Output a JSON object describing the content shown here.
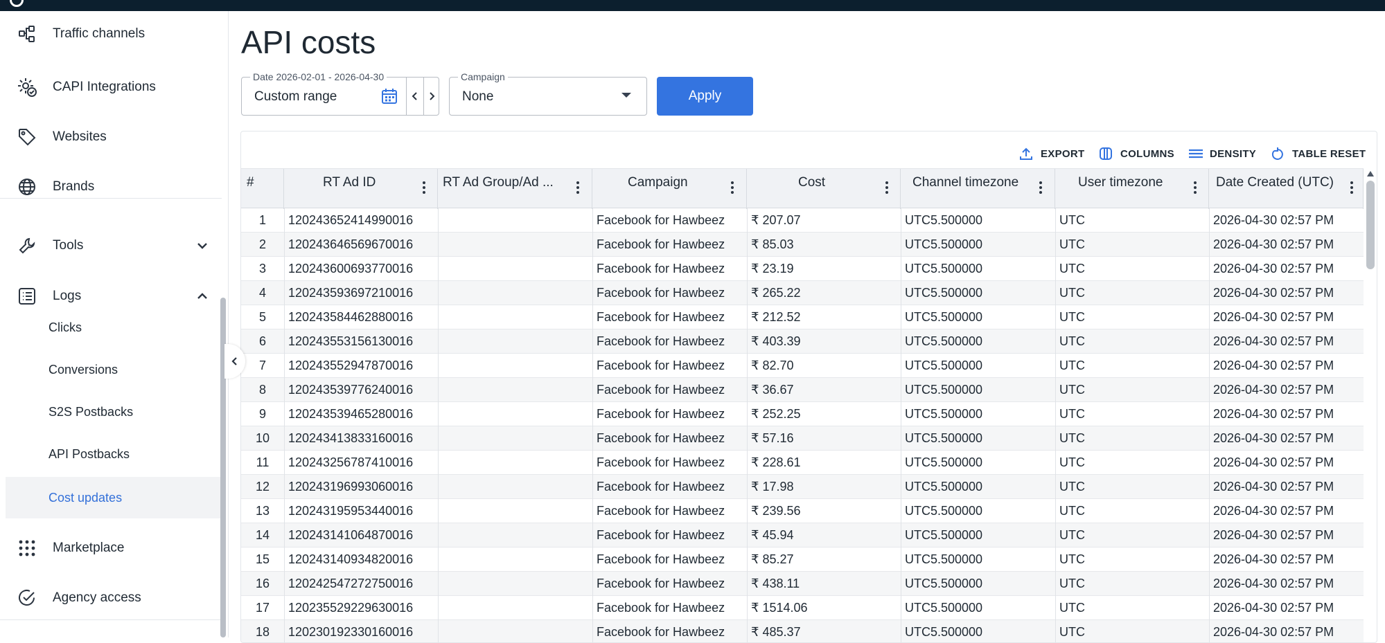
{
  "sidebar": {
    "items": [
      {
        "label": "Traffic channels",
        "icon": "share-nodes-icon"
      },
      {
        "label": "CAPI Integrations",
        "icon": "gear-check-icon"
      },
      {
        "label": "Websites",
        "icon": "tag-icon"
      },
      {
        "label": "Brands",
        "icon": "globe-icon"
      },
      {
        "label": "Tools",
        "icon": "wrench-icon"
      },
      {
        "label": "Logs",
        "icon": "list-icon"
      },
      {
        "label": "Marketplace",
        "icon": "grid-dots-icon"
      },
      {
        "label": "Agency access",
        "icon": "check-circle-icon"
      }
    ],
    "log_sub_items": [
      "Clicks",
      "Conversions",
      "S2S Postbacks",
      "API Postbacks",
      "Cost updates"
    ],
    "active_sub_item": "Cost updates"
  },
  "main": {
    "title": "API costs",
    "date_filter": {
      "legend": "Date 2026-02-01 - 2026-04-30",
      "value": "Custom range"
    },
    "campaign_filter": {
      "legend": "Campaign",
      "value": "None"
    },
    "apply_label": "Apply"
  },
  "toolbar": {
    "export": "EXPORT",
    "columns": "COLUMNS",
    "density": "DENSITY",
    "table_reset": "TABLE RESET"
  },
  "table": {
    "columns": [
      "#",
      "RT Ad ID",
      "RT Ad Group/Ad ...",
      "Campaign",
      "Cost",
      "Channel timezone",
      "User timezone",
      "Date Created (UTC)"
    ],
    "rows": [
      [
        "1",
        "120243652414990016",
        "",
        "Facebook for Hawbeez",
        "₹ 207.07",
        "UTC5.500000",
        "UTC",
        "2026-04-30 02:57 PM"
      ],
      [
        "2",
        "120243646569670016",
        "",
        "Facebook for Hawbeez",
        "₹ 85.03",
        "UTC5.500000",
        "UTC",
        "2026-04-30 02:57 PM"
      ],
      [
        "3",
        "120243600693770016",
        "",
        "Facebook for Hawbeez",
        "₹ 23.19",
        "UTC5.500000",
        "UTC",
        "2026-04-30 02:57 PM"
      ],
      [
        "4",
        "120243593697210016",
        "",
        "Facebook for Hawbeez",
        "₹ 265.22",
        "UTC5.500000",
        "UTC",
        "2026-04-30 02:57 PM"
      ],
      [
        "5",
        "120243584462880016",
        "",
        "Facebook for Hawbeez",
        "₹ 212.52",
        "UTC5.500000",
        "UTC",
        "2026-04-30 02:57 PM"
      ],
      [
        "6",
        "120243553156130016",
        "",
        "Facebook for Hawbeez",
        "₹ 403.39",
        "UTC5.500000",
        "UTC",
        "2026-04-30 02:57 PM"
      ],
      [
        "7",
        "120243552947870016",
        "",
        "Facebook for Hawbeez",
        "₹ 82.70",
        "UTC5.500000",
        "UTC",
        "2026-04-30 02:57 PM"
      ],
      [
        "8",
        "120243539776240016",
        "",
        "Facebook for Hawbeez",
        "₹ 36.67",
        "UTC5.500000",
        "UTC",
        "2026-04-30 02:57 PM"
      ],
      [
        "9",
        "120243539465280016",
        "",
        "Facebook for Hawbeez",
        "₹ 252.25",
        "UTC5.500000",
        "UTC",
        "2026-04-30 02:57 PM"
      ],
      [
        "10",
        "120243413833160016",
        "",
        "Facebook for Hawbeez",
        "₹ 57.16",
        "UTC5.500000",
        "UTC",
        "2026-04-30 02:57 PM"
      ],
      [
        "11",
        "120243256787410016",
        "",
        "Facebook for Hawbeez",
        "₹ 228.61",
        "UTC5.500000",
        "UTC",
        "2026-04-30 02:57 PM"
      ],
      [
        "12",
        "120243196993060016",
        "",
        "Facebook for Hawbeez",
        "₹ 17.98",
        "UTC5.500000",
        "UTC",
        "2026-04-30 02:57 PM"
      ],
      [
        "13",
        "120243195953440016",
        "",
        "Facebook for Hawbeez",
        "₹ 239.56",
        "UTC5.500000",
        "UTC",
        "2026-04-30 02:57 PM"
      ],
      [
        "14",
        "120243141064870016",
        "",
        "Facebook for Hawbeez",
        "₹ 45.94",
        "UTC5.500000",
        "UTC",
        "2026-04-30 02:57 PM"
      ],
      [
        "15",
        "120243140934820016",
        "",
        "Facebook for Hawbeez",
        "₹ 85.27",
        "UTC5.500000",
        "UTC",
        "2026-04-30 02:57 PM"
      ],
      [
        "16",
        "120242547272750016",
        "",
        "Facebook for Hawbeez",
        "₹ 438.11",
        "UTC5.500000",
        "UTC",
        "2026-04-30 02:57 PM"
      ],
      [
        "17",
        "120235529229630016",
        "",
        "Facebook for Hawbeez",
        "₹ 1514.06",
        "UTC5.500000",
        "UTC",
        "2026-04-30 02:57 PM"
      ],
      [
        "18",
        "120230192330160016",
        "",
        "Facebook for Hawbeez",
        "₹ 485.37",
        "UTC5.500000",
        "UTC",
        "2026-04-30 02:57 PM"
      ]
    ]
  },
  "colors": {
    "accent": "#3474e0",
    "topbar": "#0c1f2e",
    "active_link": "#3370d9"
  }
}
